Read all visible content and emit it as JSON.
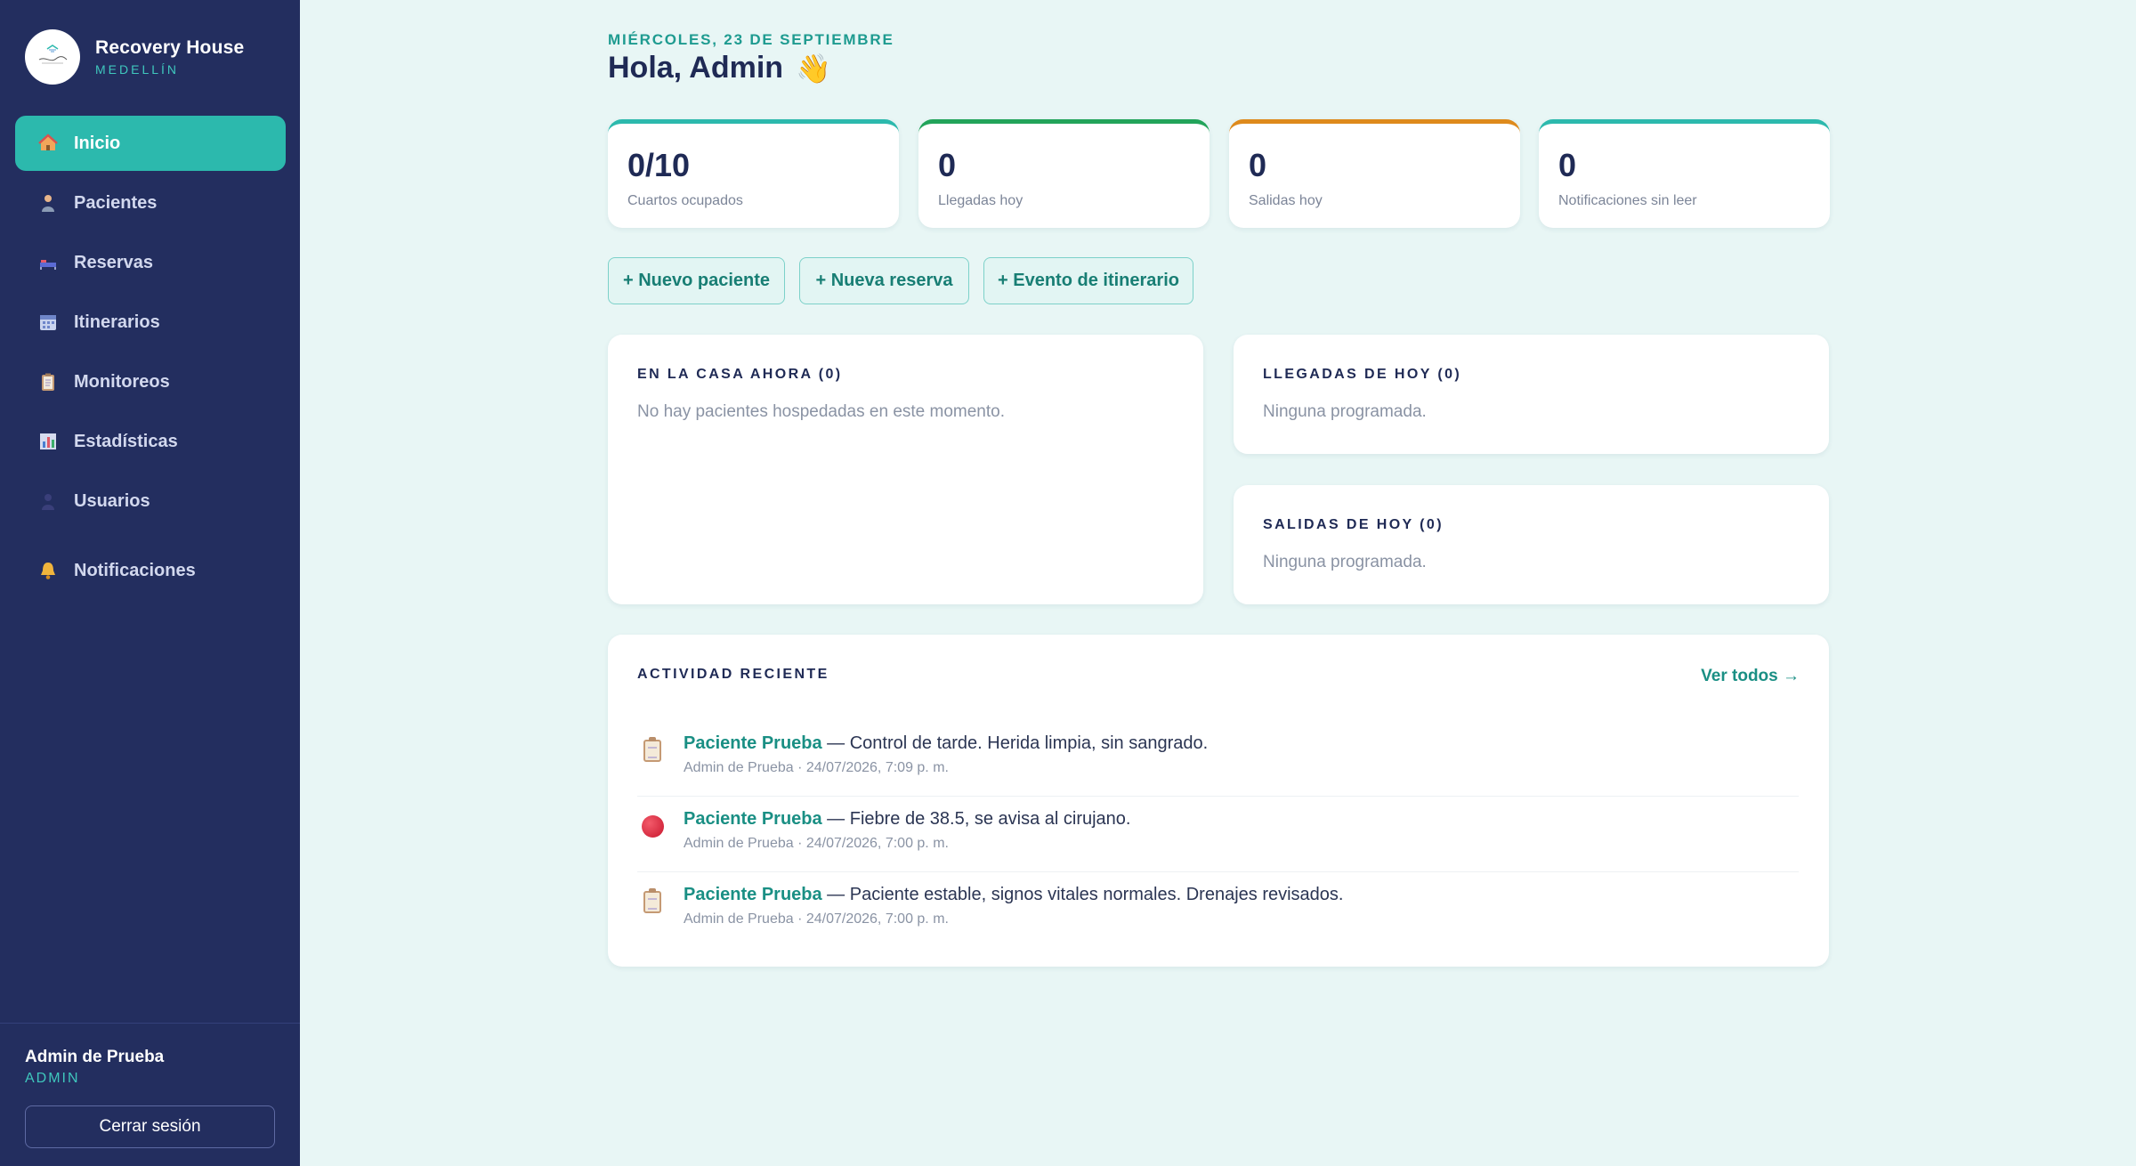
{
  "brand": {
    "name": "Recovery House",
    "city": "MEDELLÍN",
    "logo_icon": "recovery-house-logo"
  },
  "nav": [
    {
      "label": "Inicio",
      "icon": "house-icon",
      "active": true
    },
    {
      "label": "Pacientes",
      "icon": "person-icon",
      "active": false
    },
    {
      "label": "Reservas",
      "icon": "bed-icon",
      "active": false
    },
    {
      "label": "Itinerarios",
      "icon": "calendar-icon",
      "active": false
    },
    {
      "label": "Monitoreos",
      "icon": "clipboard-icon",
      "active": false
    },
    {
      "label": "Estadísticas",
      "icon": "bar-chart-icon",
      "active": false
    },
    {
      "label": "Usuarios",
      "icon": "user-icon",
      "active": false
    },
    {
      "label": "Notificaciones",
      "icon": "bell-icon",
      "active": false
    }
  ],
  "user": {
    "name": "Admin de Prueba",
    "role": "ADMIN",
    "logout_label": "Cerrar sesión"
  },
  "header": {
    "date": "MIÉRCOLES, 23 DE SEPTIEMBRE",
    "greeting": "Hola, Admin",
    "wave": "👋"
  },
  "stats": [
    {
      "value": "0/10",
      "label": "Cuartos ocupados",
      "color": "#2cb9ad"
    },
    {
      "value": "0",
      "label": "Llegadas hoy",
      "color": "#22a45a"
    },
    {
      "value": "0",
      "label": "Salidas hoy",
      "color": "#de8a1c"
    },
    {
      "value": "0",
      "label": "Notificaciones sin leer",
      "color": "#2cb9ad"
    }
  ],
  "actions": {
    "new_patient": "+ Nuevo paciente",
    "new_reservation": "+ Nueva reserva",
    "new_event": "+ Evento de itinerario"
  },
  "in_house": {
    "title": "EN LA CASA AHORA (0)",
    "empty": "No hay pacientes hospedadas en este momento."
  },
  "arrivals": {
    "title": "LLEGADAS DE HOY (0)",
    "empty": "Ninguna programada."
  },
  "departures": {
    "title": "SALIDAS DE HOY (0)",
    "empty": "Ninguna programada."
  },
  "recent": {
    "title": "ACTIVIDAD RECIENTE",
    "see_all": "Ver todos →",
    "items": [
      {
        "icon": "clipboard-icon",
        "patient": "Paciente Prueba",
        "text": " — Control de tarde. Herida limpia, sin sangrado.",
        "meta": "Admin de Prueba · 24/07/2026, 7:09 p. m."
      },
      {
        "icon": "red-circle-icon",
        "patient": "Paciente Prueba",
        "text": " — Fiebre de 38.5, se avisa al cirujano.",
        "meta": "Admin de Prueba · 24/07/2026, 7:00 p. m."
      },
      {
        "icon": "clipboard-icon",
        "patient": "Paciente Prueba",
        "text": " — Paciente estable, signos vitales normales. Drenajes revisados.",
        "meta": "Admin de Prueba · 24/07/2026, 7:00 p. m."
      }
    ]
  }
}
